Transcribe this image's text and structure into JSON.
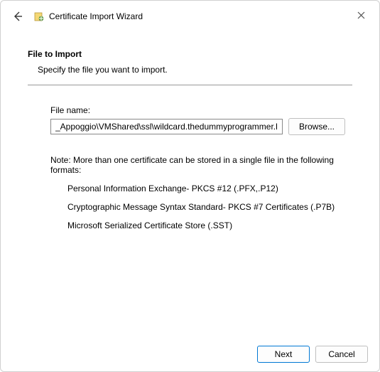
{
  "window": {
    "title": "Certificate Import Wizard"
  },
  "page": {
    "heading": "File to Import",
    "subheading": "Specify the file you want to import."
  },
  "file": {
    "label": "File name:",
    "value": "_Appoggio\\VMShared\\ssl\\wildcard.thedummyprogrammer.local.pfx",
    "browse_label": "Browse..."
  },
  "note": {
    "intro": "Note:  More than one certificate can be stored in a single file in the following formats:",
    "items": [
      "Personal Information Exchange- PKCS #12 (.PFX,.P12)",
      "Cryptographic Message Syntax Standard- PKCS #7 Certificates (.P7B)",
      "Microsoft Serialized Certificate Store (.SST)"
    ]
  },
  "footer": {
    "next_label": "Next",
    "cancel_label": "Cancel"
  }
}
